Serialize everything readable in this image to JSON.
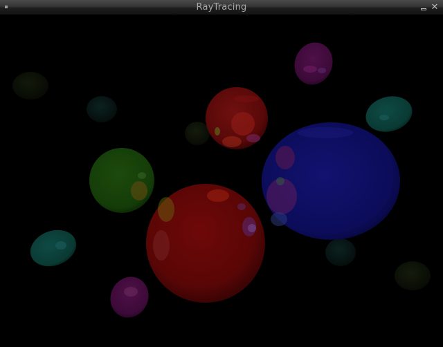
{
  "window": {
    "title": "RayTracing",
    "close_glyph": "✕",
    "icons": [
      "window-menu-icon",
      "minimize-icon",
      "close-icon"
    ]
  },
  "scene": {
    "background": "#000000",
    "spheres": [
      {
        "name": "red-sphere-large",
        "color": "#a01010"
      },
      {
        "name": "blue-sphere-large",
        "color": "#1a1a9e"
      },
      {
        "name": "red-sphere-upper",
        "color": "#a51414"
      },
      {
        "name": "green-sphere",
        "color": "#1f6a10"
      },
      {
        "name": "magenta-sphere-top",
        "color": "#7a1670"
      },
      {
        "name": "cyan-sphere-right",
        "color": "#137a6c"
      },
      {
        "name": "cyan-sphere-left",
        "color": "#137a6c"
      },
      {
        "name": "magenta-sphere-bottom",
        "color": "#7a1670"
      },
      {
        "name": "dim-sphere-left",
        "color": "#2a3a10"
      },
      {
        "name": "dim-teal-sphere",
        "color": "#0e3a38"
      },
      {
        "name": "dim-center-sphere",
        "color": "#1a2a14"
      },
      {
        "name": "dim-teal-sphere-mid",
        "color": "#0e3a30"
      },
      {
        "name": "dim-olive-sphere-right",
        "color": "#252a10"
      }
    ]
  }
}
